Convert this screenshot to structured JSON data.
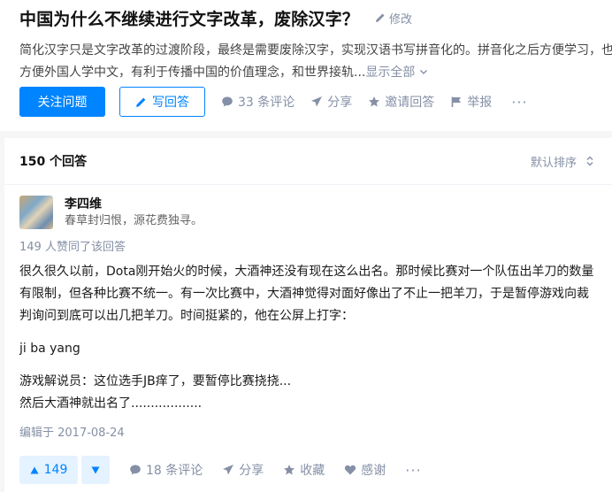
{
  "question": {
    "title": "中国为什么不继续进行文字改革，废除汉字？",
    "edit_label": "修改",
    "description": "简化汉字只是文字改革的过渡阶段，最终是需要废除汉字，实现汉语书写拼音化的。拼音化之后方便学习，也方便外国人学中文，有利于传播中国的价值理念，和世界接轨...",
    "show_all_label": "显示全部",
    "follow_label": "关注问题",
    "write_answer_label": "写回答",
    "comments_label": "33 条评论",
    "share_label": "分享",
    "invite_label": "邀请回答",
    "report_label": "举报",
    "more_label": "···"
  },
  "answers_header": {
    "count_label": "150 个回答",
    "sort_label": "默认排序"
  },
  "answer": {
    "author_name": "李四维",
    "author_bio": "春草封归恨，源花费独寻。",
    "voters_label": "149 人赞同了该回答",
    "paragraphs": [
      "很久很久以前，Dota刚开始火的时候，大酒神还没有现在这么出名。那时候比赛对一个队伍出羊刀的数量有限制，但各种比赛不统一。有一次比赛中，大酒神觉得对面好像出了不止一把羊刀，于是暂停游戏向裁判询问到底可以出几把羊刀。时间挺紧的，他在公屏上打字：",
      "ji ba yang",
      "游戏解说员：这位选手JB痒了，要暂停比赛挠挠...",
      "然后大酒神就出名了.................."
    ],
    "edited_label": "编辑于 2017-08-24",
    "upvote_count": "149",
    "comments_label": "18 条评论",
    "share_label": "分享",
    "favorite_label": "收藏",
    "thanks_label": "感谢",
    "more_label": "···"
  },
  "colors": {
    "brand": "#0084ff",
    "muted": "#8590a6",
    "vote_bg": "#e5f2ff"
  }
}
